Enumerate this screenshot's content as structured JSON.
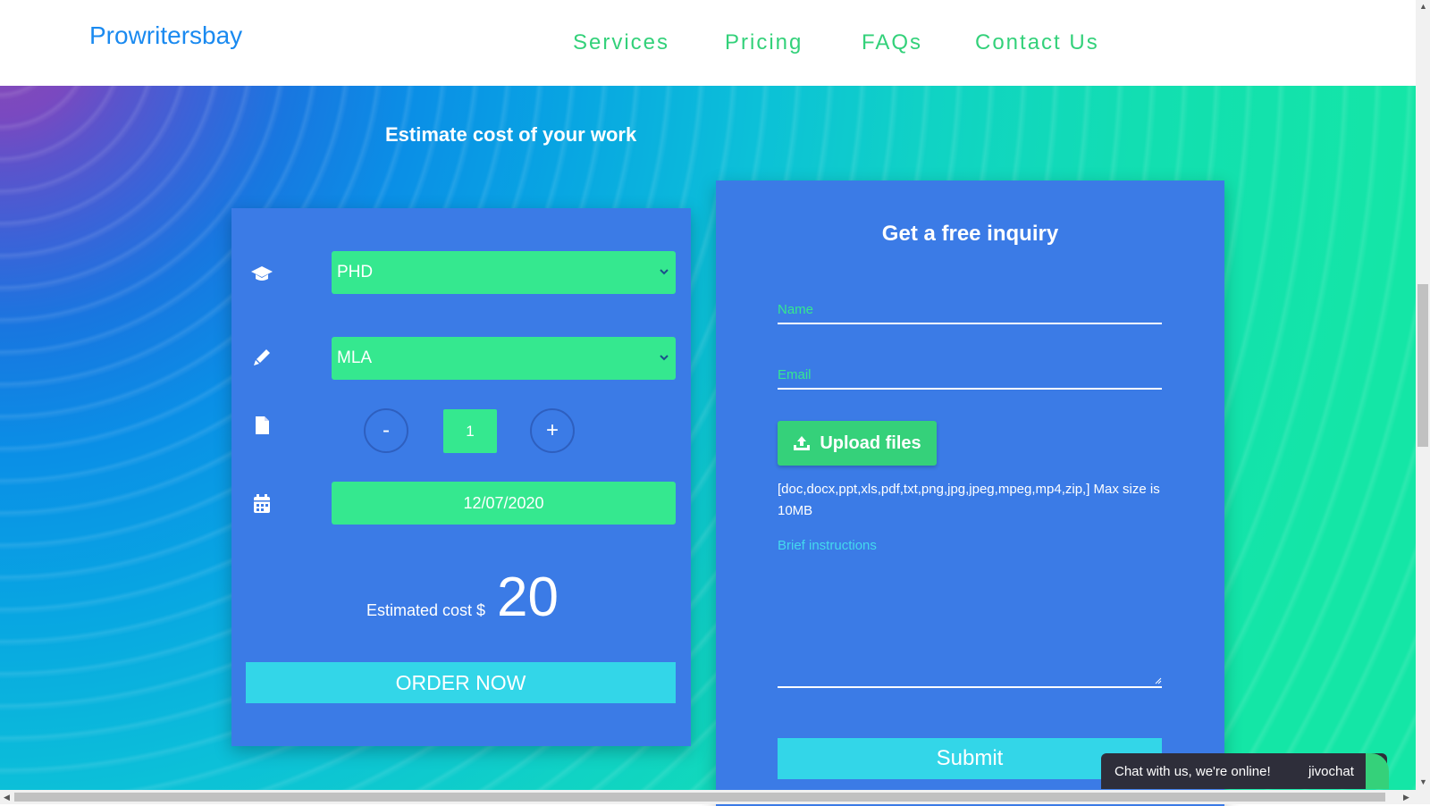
{
  "navbar": {
    "brand": "Prowritersbay",
    "links": [
      "Services",
      "Pricing",
      "FAQs",
      "Contact Us"
    ]
  },
  "estimate": {
    "section_title": "Estimate cost of your work",
    "academic_level": "PHD",
    "citation_style": "MLA",
    "minus_label": "-",
    "plus_label": "+",
    "pages": "1",
    "deadline": "12/07/2020",
    "cost_label": "Estimated cost $",
    "cost_value": "20",
    "order_label": "ORDER NOW"
  },
  "inquiry": {
    "title": "Get a free inquiry",
    "name_placeholder": "Name",
    "email_placeholder": "Email",
    "upload_label": "Upload files",
    "file_note": "[doc,docx,ppt,xls,pdf,txt,png,jpg,jpeg,mpeg,mp4,zip,] Max size is 10MB",
    "brief_label": "Brief instructions",
    "submit_label": "Submit"
  },
  "chat": {
    "text": "Chat with us, we're online!",
    "brand": "jivochat"
  },
  "colors": {
    "brand": "#1a8af0",
    "nav_link": "#33d17a",
    "card": "#3b7be6",
    "field_green": "#35e88f",
    "cyan_button": "#33d6e8"
  }
}
